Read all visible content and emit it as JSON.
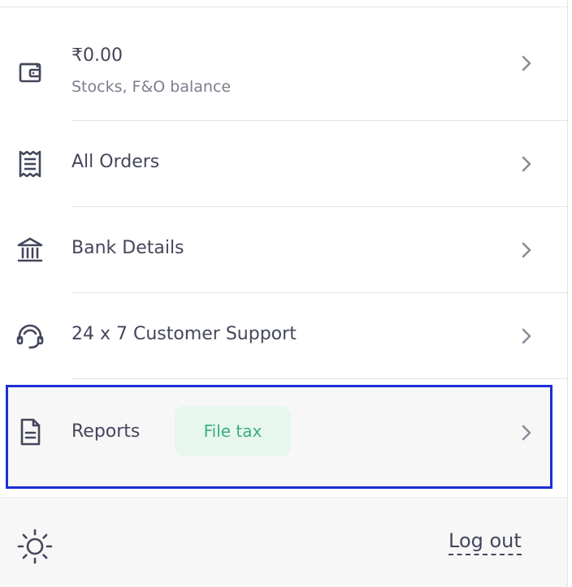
{
  "menu": {
    "balance": {
      "amount": "₹0.00",
      "subtitle": "Stocks, F&O balance",
      "icon": "wallet-icon"
    },
    "items": [
      {
        "label": "All Orders",
        "icon": "receipt-icon"
      },
      {
        "label": "Bank Details",
        "icon": "bank-icon"
      },
      {
        "label": "24 x 7 Customer Support",
        "icon": "headset-icon"
      }
    ],
    "reports": {
      "label": "Reports",
      "badge": "File tax",
      "icon": "document-icon"
    }
  },
  "footer": {
    "logout_label": "Log out",
    "theme_icon": "sun-icon"
  },
  "colors": {
    "text": "#44475b",
    "muted": "#7c7e8c",
    "badge_bg": "#e7f6ee",
    "badge_text": "#3cae82",
    "highlight_border": "#1c2fd6",
    "footer_bg": "#f7f7f8"
  }
}
